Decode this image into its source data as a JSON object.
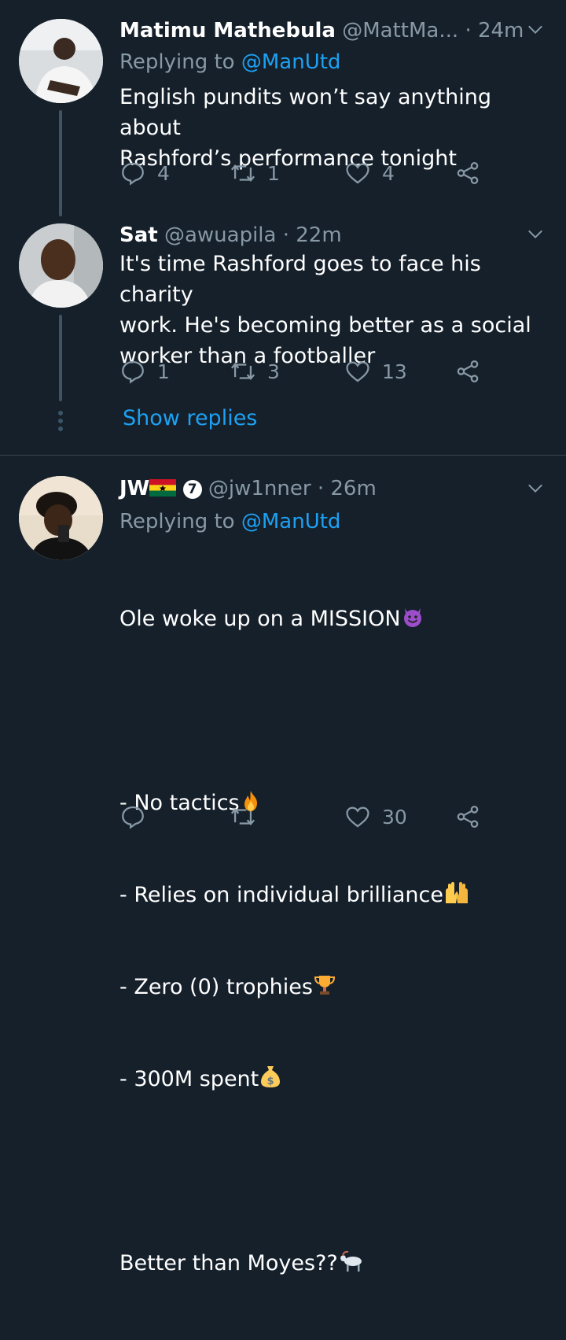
{
  "tweets": [
    {
      "name": "Matimu Mathebula",
      "handle": "@MattMa...",
      "time": "24m",
      "replying_prefix": "Replying to",
      "replying_to": "@ManUtd",
      "body": "English pundits won’t say anything about\nRashford’s performance tonight",
      "replies": "4",
      "retweets": "1",
      "likes": "4"
    },
    {
      "name": "Sat",
      "handle": "@awuapila",
      "time": "22m",
      "body": "It's time Rashford goes to face his charity\nwork. He's becoming better as a social\nworker than a footballer",
      "replies": "1",
      "retweets": "3",
      "likes": "13",
      "show_replies": "Show replies"
    },
    {
      "name": "JW",
      "badge": "7",
      "handle": "@jw1nner",
      "time": "26m",
      "replying_prefix": "Replying to",
      "replying_to": "@ManUtd",
      "lines": [
        "Ole woke up on a MISSION",
        "- No tactics",
        "- Relies on individual brilliance",
        "- Zero (0) trophies",
        "- 300M spent",
        "Better than Moyes??"
      ],
      "emojis": [
        "smiling-devil",
        "fire",
        "raised-hands",
        "trophy",
        "money-bag",
        "goat"
      ],
      "replies": "",
      "retweets": "",
      "likes": "30"
    }
  ],
  "colors": {
    "background": "#15202b",
    "secondary_text": "#8899a6",
    "link": "#1da1f2",
    "thread_line": "#3d5466",
    "divider": "#38444d"
  }
}
